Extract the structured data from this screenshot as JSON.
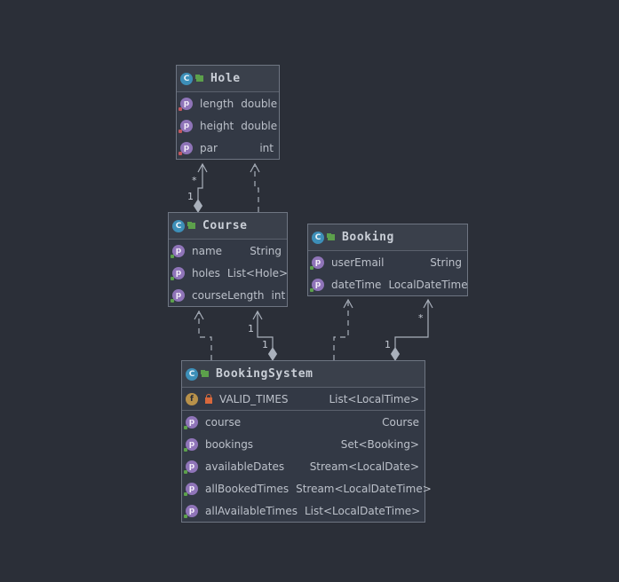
{
  "diagram": {
    "classes": [
      {
        "id": "hole",
        "name": "Hole",
        "badge": "C",
        "sections": [
          [
            {
              "kind": "p",
              "name": "length",
              "type": "double"
            },
            {
              "kind": "p",
              "name": "height",
              "type": "double"
            },
            {
              "kind": "p",
              "name": "par",
              "type": "int"
            }
          ]
        ]
      },
      {
        "id": "course",
        "name": "Course",
        "badge": "C",
        "sections": [
          [
            {
              "kind": "p",
              "name": "name",
              "type": "String"
            },
            {
              "kind": "p",
              "name": "holes",
              "type": "List<Hole>"
            },
            {
              "kind": "p",
              "name": "courseLength",
              "type": "int"
            }
          ]
        ]
      },
      {
        "id": "booking",
        "name": "Booking",
        "badge": "C",
        "sections": [
          [
            {
              "kind": "p",
              "name": "userEmail",
              "type": "String"
            },
            {
              "kind": "p",
              "name": "dateTime",
              "type": "LocalDateTime"
            }
          ]
        ]
      },
      {
        "id": "bookingsystem",
        "name": "BookingSystem",
        "badge": "C",
        "sections": [
          [
            {
              "kind": "f",
              "name": "VALID_TIMES",
              "type": "List<LocalTime>"
            }
          ],
          [
            {
              "kind": "p",
              "name": "course",
              "type": "Course"
            },
            {
              "kind": "p",
              "name": "bookings",
              "type": "Set<Booking>"
            },
            {
              "kind": "p",
              "name": "availableDates",
              "type": "Stream<LocalDate>"
            },
            {
              "kind": "p",
              "name": "allBookedTimes",
              "type": "Stream<LocalDateTime>"
            },
            {
              "kind": "p",
              "name": "allAvailableTimes",
              "type": "List<LocalDateTime>"
            }
          ]
        ]
      }
    ],
    "relations": [
      {
        "from": "course",
        "to": "hole",
        "kind": "composition",
        "source_mult": "1",
        "target_mult": "*"
      },
      {
        "from": "course",
        "to": "hole",
        "kind": "dependency"
      },
      {
        "from": "bookingsystem",
        "to": "course",
        "kind": "dependency"
      },
      {
        "from": "bookingsystem",
        "to": "course",
        "kind": "composition",
        "source_mult": "1",
        "target_mult": "1"
      },
      {
        "from": "bookingsystem",
        "to": "booking",
        "kind": "dependency"
      },
      {
        "from": "bookingsystem",
        "to": "booking",
        "kind": "composition",
        "source_mult": "1",
        "target_mult": "*"
      }
    ]
  }
}
